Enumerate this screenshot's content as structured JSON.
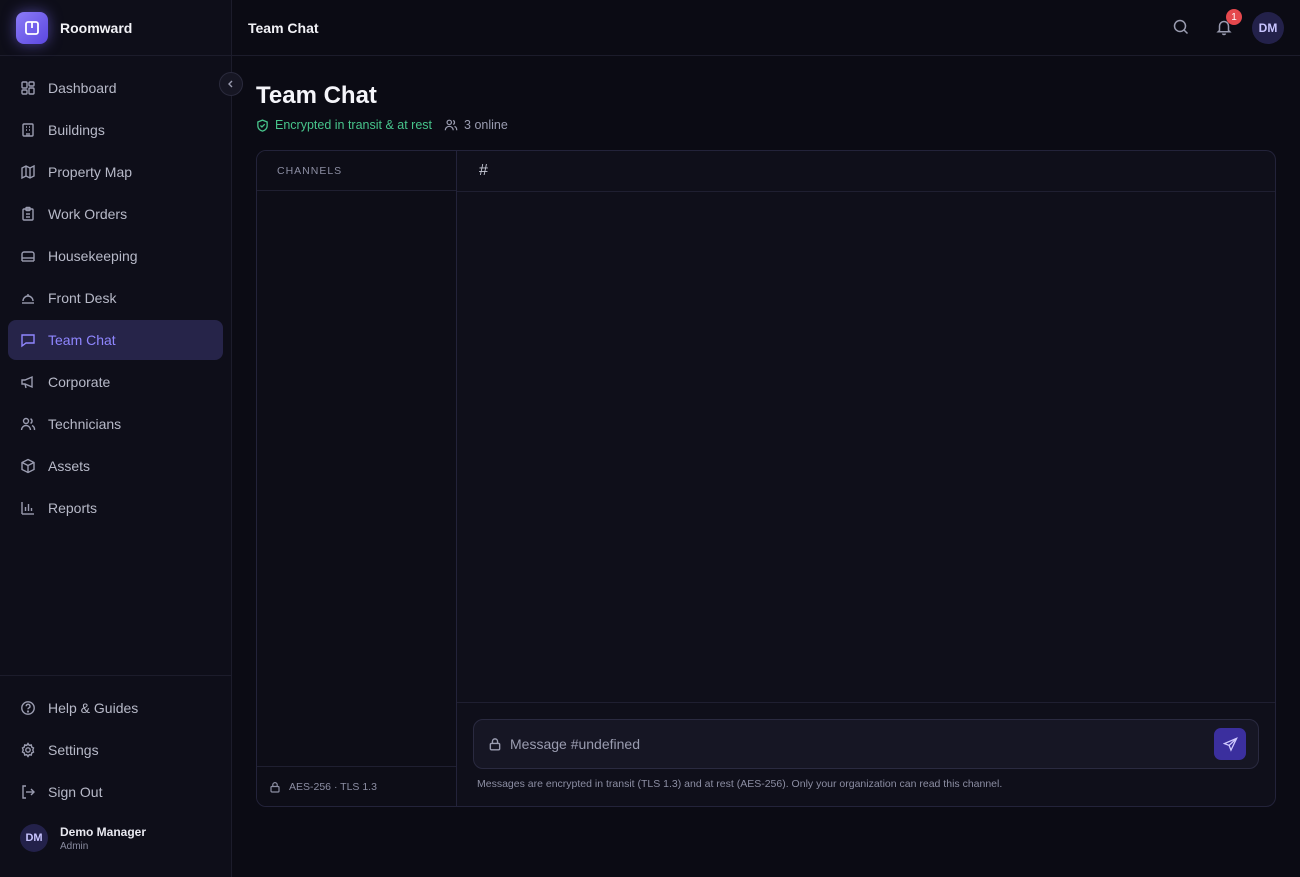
{
  "app": {
    "name": "Roomward"
  },
  "colors": {
    "accent": "#7c6cf6",
    "active_bg": "#262449",
    "success": "#47c48b",
    "badge": "#e5484d",
    "background": "#0b0b14"
  },
  "sidebar": {
    "items": [
      {
        "label": "Dashboard",
        "icon": "dashboard-icon"
      },
      {
        "label": "Buildings",
        "icon": "building-icon"
      },
      {
        "label": "Property Map",
        "icon": "map-icon"
      },
      {
        "label": "Work Orders",
        "icon": "clipboard-icon"
      },
      {
        "label": "Housekeeping",
        "icon": "bed-icon"
      },
      {
        "label": "Front Desk",
        "icon": "bell-concierge-icon"
      },
      {
        "label": "Team Chat",
        "icon": "message-square-icon",
        "active": true
      },
      {
        "label": "Corporate",
        "icon": "megaphone-icon"
      },
      {
        "label": "Technicians",
        "icon": "users-icon"
      },
      {
        "label": "Assets",
        "icon": "package-icon"
      },
      {
        "label": "Reports",
        "icon": "bar-chart-icon"
      }
    ],
    "bottom_items": [
      {
        "label": "Help & Guides",
        "icon": "help-circle-icon"
      },
      {
        "label": "Settings",
        "icon": "gear-icon"
      },
      {
        "label": "Sign Out",
        "icon": "log-out-icon"
      }
    ],
    "user": {
      "initials": "DM",
      "name": "Demo Manager",
      "role": "Admin"
    }
  },
  "topbar": {
    "title": "Team Chat",
    "notification_count": "1",
    "avatar_initials": "DM"
  },
  "page": {
    "title": "Team Chat",
    "encryption_status": "Encrypted in transit & at rest",
    "online_count": "3 online"
  },
  "chat": {
    "channels_header": "CHANNELS",
    "channels_footer": "AES-256 · TLS 1.3",
    "channel_hash": "#",
    "composer_placeholder": "Message #undefined",
    "composer_note": "Messages are encrypted in transit (TLS 1.3) and at rest (AES-256). Only your organization can read this channel."
  }
}
